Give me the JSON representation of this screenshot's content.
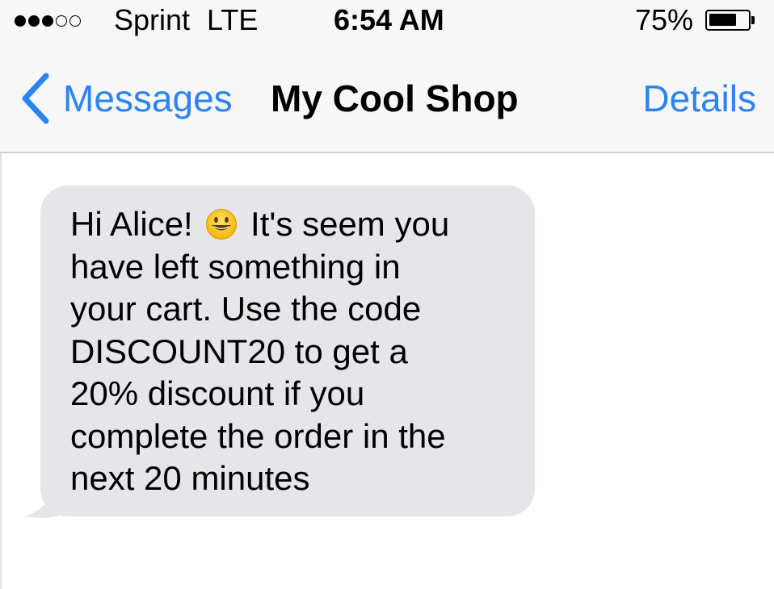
{
  "status_bar": {
    "signal_bars_filled": 3,
    "signal_bars_total": 5,
    "carrier": "Sprint",
    "network": "LTE",
    "time": "6:54 AM",
    "battery_percent": "75%",
    "battery_level": 0.75
  },
  "nav": {
    "back_label": "Messages",
    "title": "My Cool Shop",
    "details_label": "Details",
    "accent_color": "#2c83f6"
  },
  "message": {
    "text_before_emoji": "Hi Alice! ",
    "emoji": "grinning-face-icon",
    "text_after_emoji": " It's seem you\nhave left something in\nyour cart. Use the code\nDISCOUNT20 to get a\n20% discount if you\ncomplete the order in the\nnext 20 minutes",
    "bubble_color": "#e5e5ea"
  }
}
